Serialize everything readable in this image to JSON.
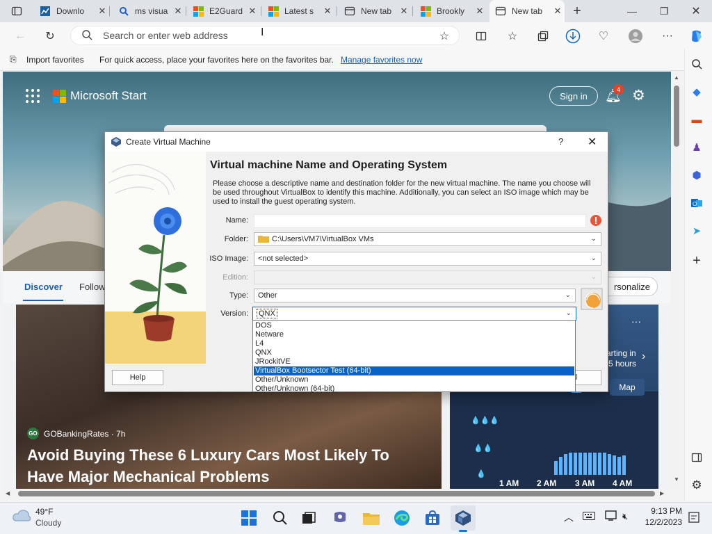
{
  "tabs": [
    {
      "title": "Downlo",
      "icon": "chart-icon"
    },
    {
      "title": "ms visua",
      "icon": "search-icon"
    },
    {
      "title": "E2Guard",
      "icon": "microsoft-logo"
    },
    {
      "title": "Latest s",
      "icon": "microsoft-logo"
    },
    {
      "title": "New tab",
      "icon": "newtab-icon"
    },
    {
      "title": "Brookly",
      "icon": "microsoft-logo"
    },
    {
      "title": "New tab",
      "icon": "newtab-icon",
      "active": true
    }
  ],
  "address": {
    "placeholder": "Search or enter web address"
  },
  "favbar": {
    "import": "Import favorites",
    "hint": "For quick access, place your favorites here on the favorites bar.",
    "manage": "Manage favorites now"
  },
  "msstart": {
    "brand": "Microsoft Start",
    "signin": "Sign in",
    "notif_count": "4"
  },
  "feed": {
    "tab_discover": "Discover",
    "tab_following": "Follow",
    "personalize": "rsonalize",
    "source": "GOBankingRates · 7h",
    "source_badge": "GO",
    "headline_line1": "Avoid Buying These 6 Luxury Cars Most Likely To",
    "headline_line2": "Have Major Mechanical Problems",
    "weather_more": "···",
    "weather_text1": "arting in",
    "weather_text2": "5 hours",
    "map_btn": "Map",
    "hours": [
      "1 AM",
      "2 AM",
      "3 AM",
      "4 AM"
    ]
  },
  "dialog": {
    "title": "Create Virtual Machine",
    "help_glyph": "?",
    "heading": "Virtual machine Name and Operating System",
    "description": "Please choose a descriptive name and destination folder for the new virtual machine. The name you choose will be used throughout VirtualBox to identify this machine. Additionally, you can select an ISO image which may be used to install the guest operating system.",
    "labels": {
      "name": "Name:",
      "folder": "Folder:",
      "iso": "ISO Image:",
      "edition": "Edition:",
      "type": "Type:",
      "version": "Version:"
    },
    "values": {
      "name": "",
      "folder": "C:\\Users\\VM7\\VirtualBox VMs",
      "iso": "<not selected>",
      "edition": "",
      "type": "Other",
      "version": "QNX"
    },
    "version_options": [
      "DOS",
      "Netware",
      "L4",
      "QNX",
      "JRockitVE",
      "VirtualBox Bootsector Test (64-bit)",
      "Other/Unknown",
      "Other/Unknown (64-bit)"
    ],
    "selected_option": "VirtualBox Bootsector Test (64-bit)",
    "help_button": "Help",
    "cancel_button_partial": "ncel"
  },
  "taskbar": {
    "temp": "49°F",
    "condition": "Cloudy",
    "time": "9:13 PM",
    "date": "12/2/2023"
  },
  "colors": {
    "accent": "#0a61c6",
    "edge_blue": "#0f6cbd",
    "notif_red": "#e0452b"
  }
}
